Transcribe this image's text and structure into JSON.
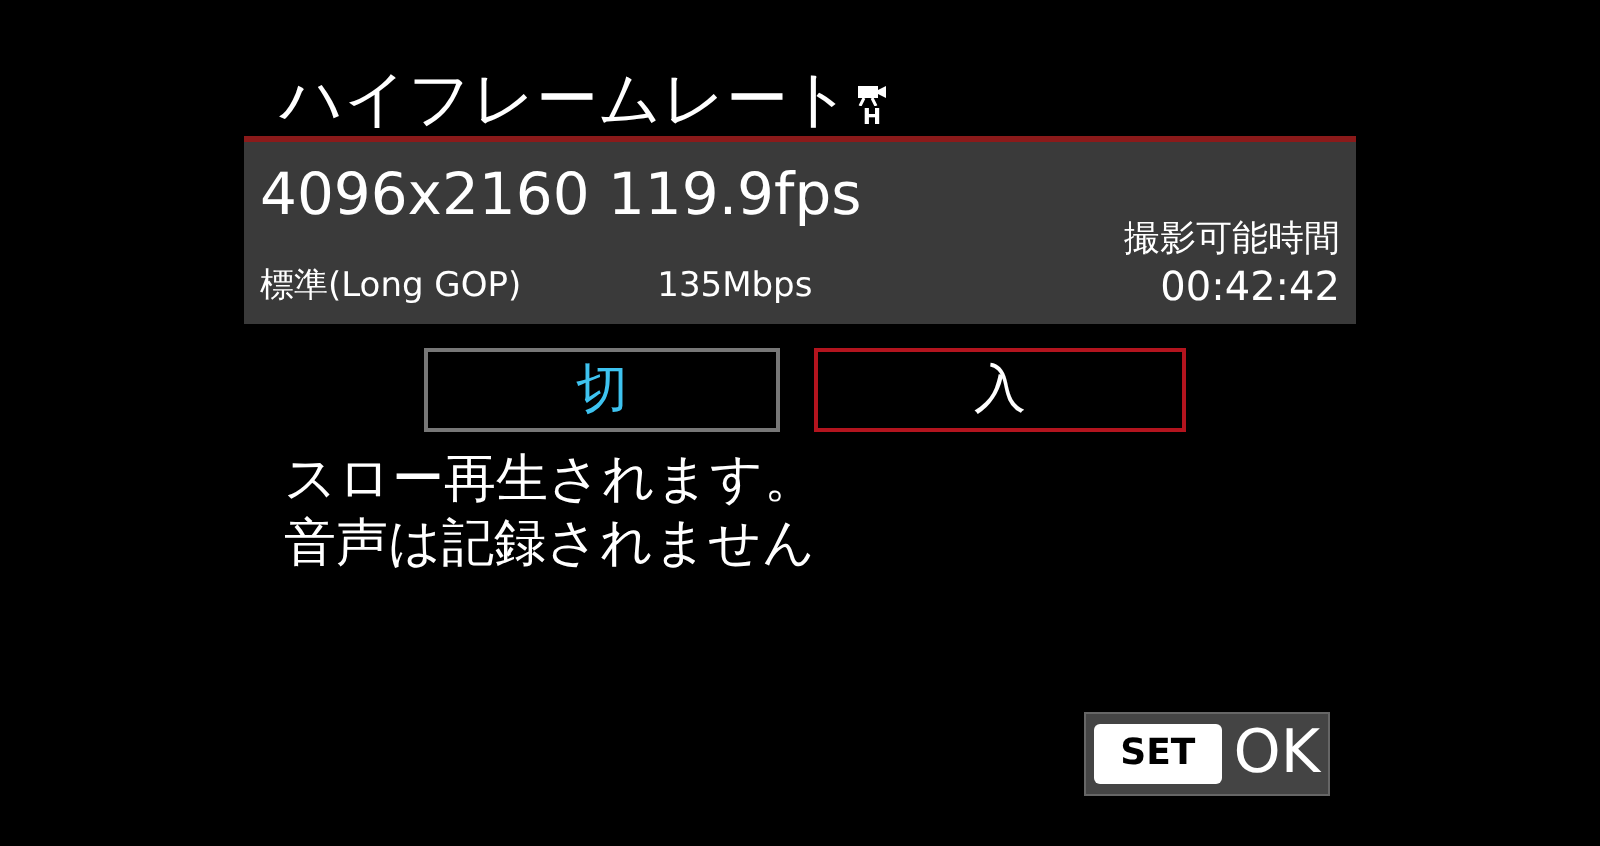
{
  "title": "ハイフレームレート",
  "title_badge": "H",
  "info": {
    "resolution": "4096x2160 119.9fps",
    "compression": "標準(Long GOP)",
    "bitrate": "135Mbps",
    "remaining_label": "撮影可能時間",
    "remaining_time": "00:42:42"
  },
  "options": [
    {
      "label": "切",
      "selected": false,
      "current": true
    },
    {
      "label": "入",
      "selected": true,
      "current": false
    }
  ],
  "message": [
    "スロー再生されます。",
    "音声は記録されません"
  ],
  "set_button": {
    "key": "SET",
    "label": "OK"
  }
}
